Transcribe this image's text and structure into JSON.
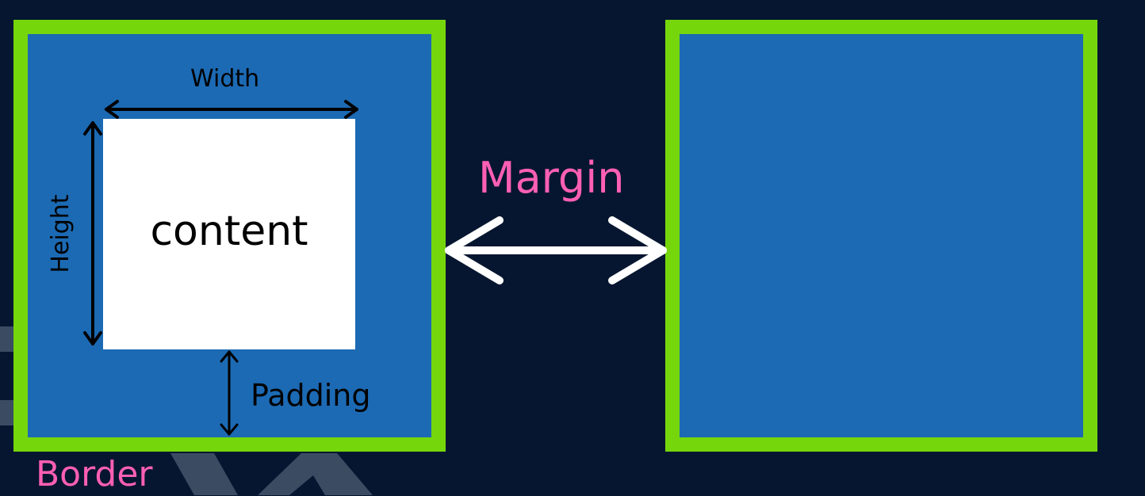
{
  "diagram": {
    "content_label": "content",
    "width_label": "Width",
    "height_label": "Height",
    "padding_label": "Padding",
    "margin_label": "Margin",
    "border_label": "Border"
  },
  "colors": {
    "background": "#061630",
    "box_fill": "#1c6ab4",
    "border_green": "#76d60c",
    "accent_pink": "#ff5fb4",
    "content_white": "#ffffff"
  }
}
